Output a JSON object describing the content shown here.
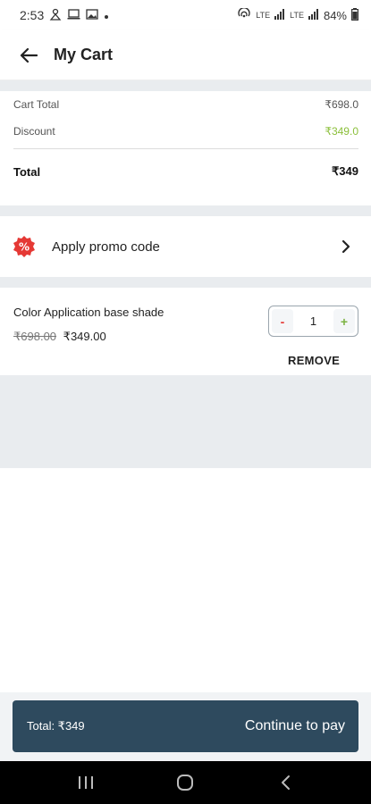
{
  "status_bar": {
    "time": "2:53",
    "lte1": "LTE",
    "lte2": "LTE",
    "battery": "84%",
    "icons": [
      "mobile-data-icon",
      "laptop-icon",
      "image-icon",
      "hotspot-icon",
      "signal-icon",
      "battery-icon"
    ]
  },
  "app_bar": {
    "title": "My Cart"
  },
  "summary": {
    "cart_total_label": "Cart Total",
    "cart_total_value": "₹698.0",
    "discount_label": "Discount",
    "discount_value": "₹349.0",
    "total_label": "Total",
    "total_value": "₹349"
  },
  "promo": {
    "label": "Apply promo code",
    "icon_glyph": "%"
  },
  "item": {
    "name": "Color Application base shade",
    "old_price": "₹698.00",
    "price": "₹349.00",
    "quantity": "1",
    "minus_label": "-",
    "plus_label": "+",
    "remove_label": "REMOVE"
  },
  "footer": {
    "total_text": "Total: ₹349",
    "pay_label": "Continue to pay"
  },
  "colors": {
    "primary": "#2e4a5e",
    "discount_green": "#8bbf3a",
    "promo_red": "#e53935",
    "background_grey": "#e9ecef"
  }
}
